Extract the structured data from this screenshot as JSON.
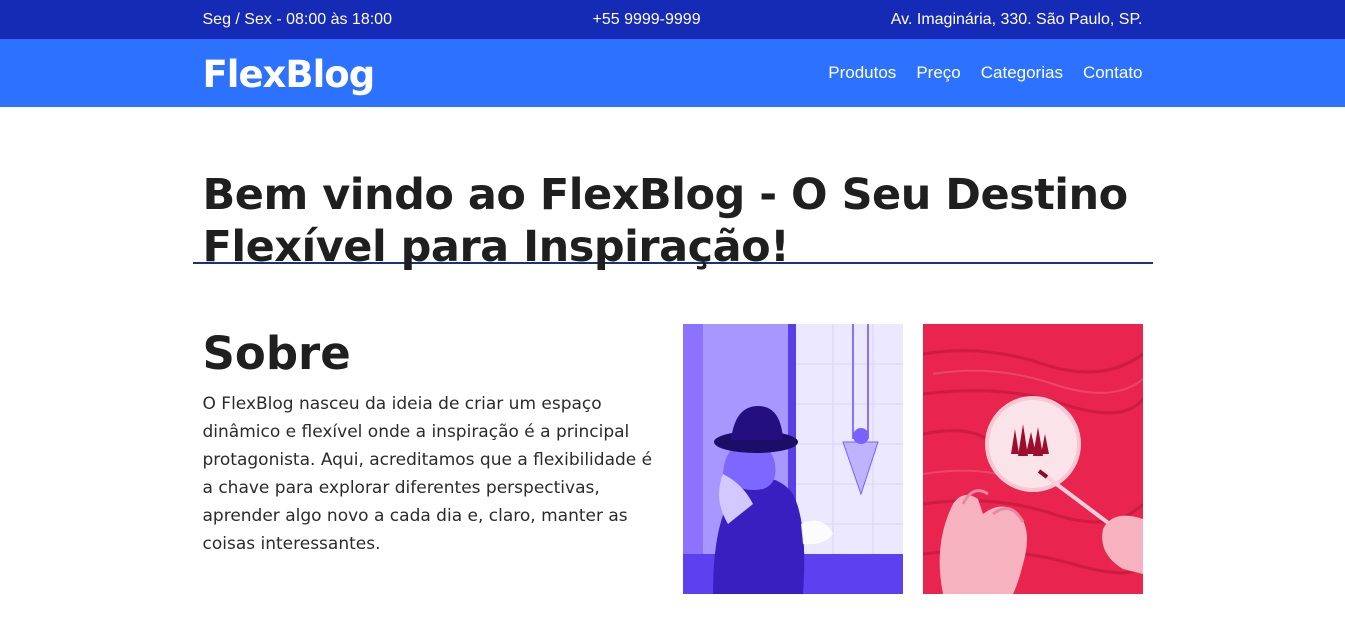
{
  "topbar": {
    "hours": "Seg / Sex - 08:00 às 18:00",
    "phone": "+55 9999-9999",
    "address": "Av. Imaginária, 330. São Paulo, SP."
  },
  "navbar": {
    "logo": "FlexBlog",
    "items": [
      {
        "label": "Produtos"
      },
      {
        "label": "Preço"
      },
      {
        "label": "Categorias"
      },
      {
        "label": "Contato"
      }
    ]
  },
  "hero": {
    "title": "Bem vindo ao FlexBlog - O Seu Destino Flexível para Inspiração!"
  },
  "about": {
    "heading": "Sobre",
    "text": "O FlexBlog nasceu da ideia de criar um espaço dinâmico e flexível onde a inspiração é a principal protagonista. Aqui, acreditamos que a flexibilidade é a chave para explorar diferentes perspectivas, aprender algo novo a cada dia e, claro, manter as coisas interessantes."
  },
  "colors": {
    "topbar": "#152ab5",
    "navbar": "#2c72ff",
    "divider": "#1d2f85",
    "photo1_tint": "#6a4bff",
    "photo2_tint": "#e8244f"
  }
}
